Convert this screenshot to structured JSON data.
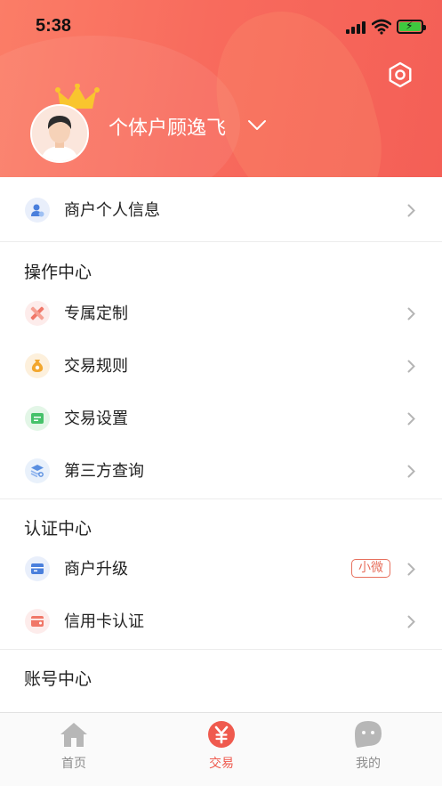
{
  "status_bar": {
    "time": "5:38"
  },
  "profile": {
    "name": "个体户顾逸飞"
  },
  "menu": {
    "merchant_info": "商户个人信息",
    "operations": {
      "title": "操作中心",
      "items": [
        "专属定制",
        "交易规则",
        "交易设置",
        "第三方查询"
      ]
    },
    "certification": {
      "title": "认证中心",
      "items": [
        "商户升级",
        "信用卡认证"
      ],
      "upgrade_badge": "小微"
    },
    "account": {
      "title": "账号中心"
    }
  },
  "tabs": [
    {
      "label": "首页",
      "icon": "home-icon"
    },
    {
      "label": "交易",
      "icon": "yuan-icon"
    },
    {
      "label": "我的",
      "icon": "face-icon"
    }
  ],
  "colors": {
    "header_gradient_start": "#fb7d67",
    "header_gradient_end": "#f45f56",
    "accent": "#ef5a4e",
    "badge": "#e7705e"
  }
}
